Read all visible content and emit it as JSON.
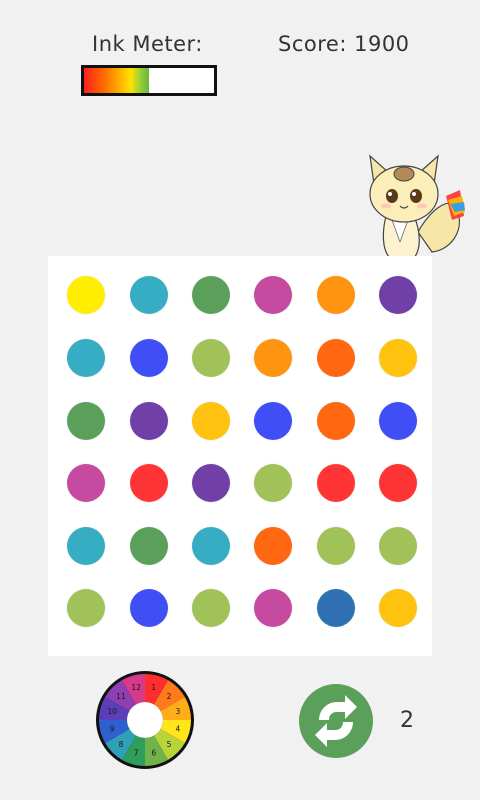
{
  "header": {
    "ink_label": "Ink Meter:",
    "score_label": "Score:",
    "score_value": "1900"
  },
  "ink_meter": {
    "level": 0.5
  },
  "palette": {
    "yellow": "#ffee00",
    "teal": "#36adc2",
    "green": "#5aa05a",
    "magenta": "#c54aa0",
    "orange": "#ff9410",
    "purple": "#7040a8",
    "blue": "#3f4ff5",
    "lime": "#a0c258",
    "dark_orange": "#ff6710",
    "amber": "#ffc20e",
    "red": "#ff3535",
    "steel": "#2e70b0"
  },
  "board": {
    "rows": [
      [
        "yellow",
        "teal",
        "green",
        "magenta",
        "orange",
        "purple"
      ],
      [
        "teal",
        "blue",
        "lime",
        "orange",
        "dark_orange",
        "amber"
      ],
      [
        "green",
        "purple",
        "amber",
        "blue",
        "dark_orange",
        "blue"
      ],
      [
        "magenta",
        "red",
        "purple",
        "lime",
        "red",
        "red"
      ],
      [
        "teal",
        "green",
        "teal",
        "dark_orange",
        "lime",
        "lime"
      ],
      [
        "lime",
        "blue",
        "lime",
        "magenta",
        "steel",
        "amber"
      ]
    ]
  },
  "color_wheel": {
    "numbers": [
      "1",
      "2",
      "3",
      "4",
      "5",
      "6",
      "7",
      "8",
      "9",
      "10",
      "11",
      "12"
    ],
    "segment_colors": [
      "#ff2d2d",
      "#ff7a1a",
      "#ffae1a",
      "#ffe51a",
      "#b8d43a",
      "#6fb34a",
      "#2f9e5a",
      "#2fa0b8",
      "#2f5fd0",
      "#5a3fb8",
      "#8f3fb0",
      "#d63a8a"
    ]
  },
  "refresh": {
    "count": "2",
    "icon": "refresh-icon",
    "color": "#5a9f5a"
  }
}
